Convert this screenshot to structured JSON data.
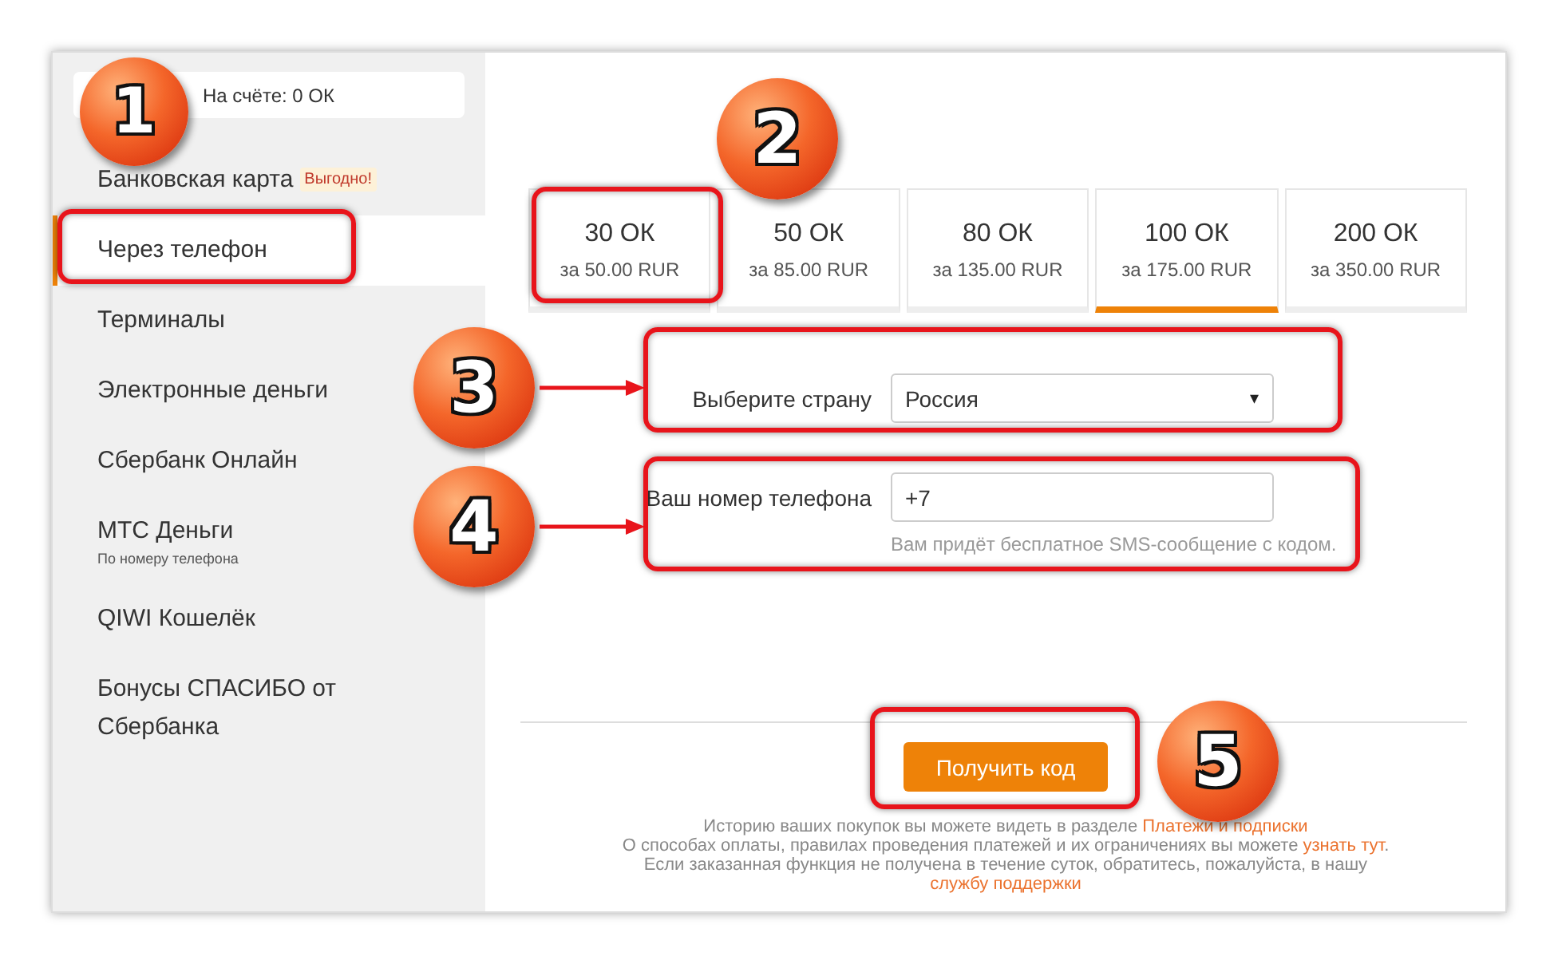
{
  "balance": "На счёте: 0 ОК",
  "sidebar": {
    "items": [
      {
        "label": "Банковская карта",
        "badge": "Выгодно!",
        "selected": false
      },
      {
        "label": "Через телефон",
        "selected": true
      },
      {
        "label": "Терминалы",
        "selected": false
      },
      {
        "label": "Электронные деньги",
        "selected": false
      },
      {
        "label": "Сбербанк Онлайн",
        "selected": false
      },
      {
        "label": "МТС Деньги",
        "sublabel": "По номеру телефона",
        "selected": false
      },
      {
        "label": "QIWI Кошелёк",
        "selected": false
      },
      {
        "label": "Бонусы СПАСИБО от Сбербанка",
        "selected": false
      }
    ]
  },
  "packages": [
    {
      "amount": "30 ОК",
      "price": "за 50.00 RUR",
      "selected": false
    },
    {
      "amount": "50 ОК",
      "price": "за 85.00 RUR",
      "selected": false
    },
    {
      "amount": "80 ОК",
      "price": "за 135.00 RUR",
      "selected": false
    },
    {
      "amount": "100 ОК",
      "price": "за 175.00 RUR",
      "selected": true
    },
    {
      "amount": "200 ОК",
      "price": "за 350.00 RUR",
      "selected": false
    }
  ],
  "form": {
    "country": {
      "label": "Выберите страну",
      "value": "Россия",
      "caret": "▾"
    },
    "phone": {
      "label": "Ваш номер телефона",
      "value": "+7",
      "hint": "Вам придёт бесплатное SMS-сообщение с кодом."
    }
  },
  "button": "Получить код",
  "footer": [
    {
      "text": "Историю ваших покупок вы можете видеть в разделе ",
      "link": "Платежи и подписки"
    },
    {
      "text": "О способах оплаты, правилах проведения платежей и их ограничениях вы можете ",
      "link": "узнать тут",
      "after": "."
    },
    {
      "text": "Если заказанная функция не получена в течение суток, обратитесь, пожалуйста, в нашу"
    },
    {
      "link": "службу поддержки"
    }
  ],
  "annotations": [
    {
      "number": "1",
      "kind": "badge"
    },
    {
      "number": "2",
      "kind": "badge"
    },
    {
      "number": "3",
      "kind": "pointer"
    },
    {
      "number": "4",
      "kind": "pointer"
    },
    {
      "number": "5",
      "kind": "badge"
    }
  ]
}
